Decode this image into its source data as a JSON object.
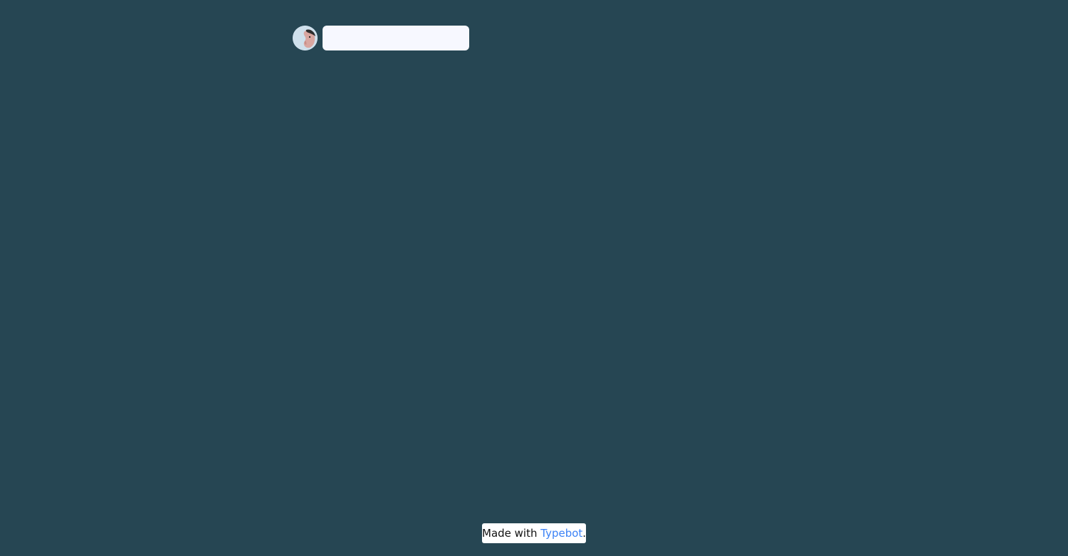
{
  "chat": {
    "avatar_icon": "user-avatar-icon",
    "message_bubble_text": ""
  },
  "branding": {
    "prefix": "Made with ",
    "link_text": "Typebot",
    "suffix": "."
  },
  "colors": {
    "background": "#264653",
    "bubble": "#f7f8ff",
    "link": "#3b82f6"
  }
}
